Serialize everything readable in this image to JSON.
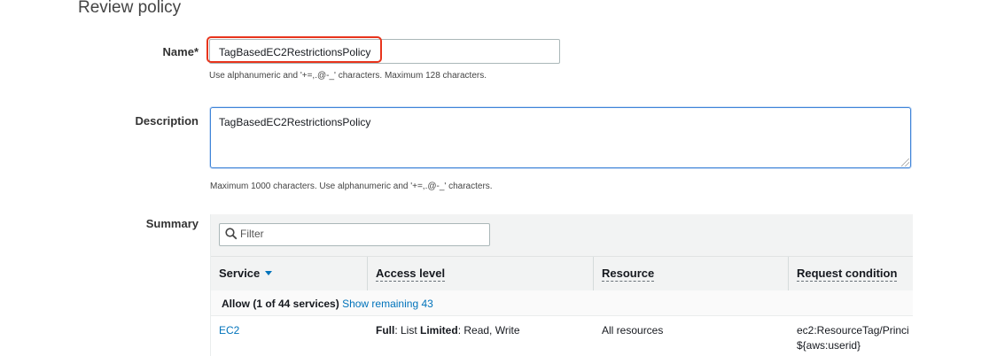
{
  "page": {
    "title": "Review policy"
  },
  "name_field": {
    "label": "Name*",
    "value": "TagBasedEC2RestrictionsPolicy",
    "hint": "Use alphanumeric and '+=,.@-_' characters. Maximum 128 characters."
  },
  "description_field": {
    "label": "Description",
    "value": "TagBasedEC2RestrictionsPolicy",
    "hint": "Maximum 1000 characters. Use alphanumeric and '+=,.@-_' characters."
  },
  "summary": {
    "label": "Summary",
    "filter_placeholder": "Filter",
    "columns": [
      "Service",
      "Access level",
      "Resource",
      "Request condition"
    ],
    "group": {
      "title": "Allow (1 of 44 services)",
      "link": "Show remaining 43"
    },
    "rows": [
      {
        "service": "EC2",
        "access_full_label": "Full",
        "access_full_value": ": List ",
        "access_limited_label": "Limited",
        "access_limited_value": ": Read, Write",
        "resource": "All resources",
        "condition_line1": "ec2:ResourceTag/Princi",
        "condition_line2": "${aws:userid}"
      }
    ]
  },
  "colors": {
    "highlight": "#e8341c",
    "link": "#0073bb",
    "focus": "#3f84d8"
  }
}
